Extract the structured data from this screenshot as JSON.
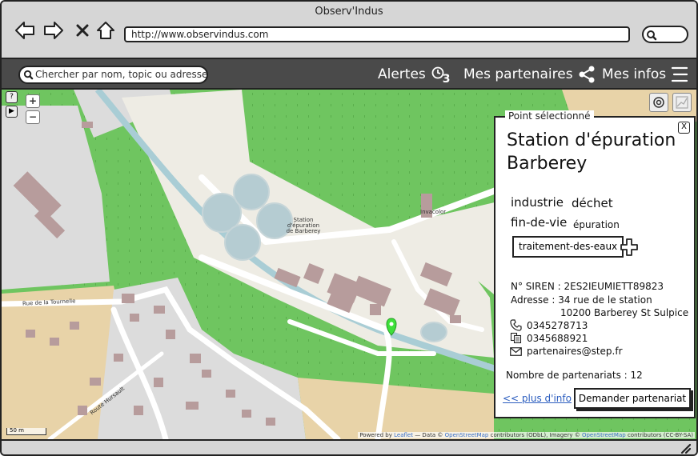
{
  "window": {
    "title": "Observ'Indus"
  },
  "browser": {
    "url": "http://www.observindus.com",
    "nav": [
      "back-icon",
      "forward-icon",
      "close-icon",
      "home-icon"
    ]
  },
  "appbar": {
    "search_placeholder": "Chercher par nom, topic ou adresse",
    "alerts_label": "Alertes",
    "alerts_count": "3",
    "partners_label": "Mes partenaires",
    "info_label": "Mes infos"
  },
  "map": {
    "labels": {
      "station": "Station d'épuration de Barberey",
      "street1": "Rue de la Tournelle",
      "street2": "Route Hursault",
      "poi": "Invacolor"
    },
    "scale": "50 m",
    "attribution": {
      "powered": "Powered by",
      "leaflet": "Leaflet",
      "data": "— Data ©",
      "osm": "OpenStreetMap",
      "contrib": "contributors (ODbL), Imagery ©",
      "osm2": "OpenStreetMap",
      "license": "contributors (CC-BY-SA)"
    },
    "colors": {
      "green": "#6fc560",
      "building": "#b79c9c",
      "road": "#ffffff",
      "river": "#a9cdd5",
      "pin": "#3ee03a"
    }
  },
  "panel": {
    "legend": "Point sélectionné",
    "close": "X",
    "title": "Station d'épuration Barberey",
    "tags": {
      "industrie": "industrie",
      "dechet": "déchet",
      "fin_de_vie": "fin-de-vie",
      "epuration": "épuration",
      "traitement": "traitement-des-eaux"
    },
    "siren": "N° SIREN : 2ES2IEUMIETT89823",
    "address_line1": "Adresse : 34 rue de le station",
    "address_line2": "10200 Barberey St Sulpice",
    "phone": "0345278713",
    "fax": "0345688921",
    "email": "partenaires@step.fr",
    "partnerships": "Nombre de partenariats : 12",
    "more_link": "<< plus d'info",
    "request_button": "Demander partenariat"
  }
}
